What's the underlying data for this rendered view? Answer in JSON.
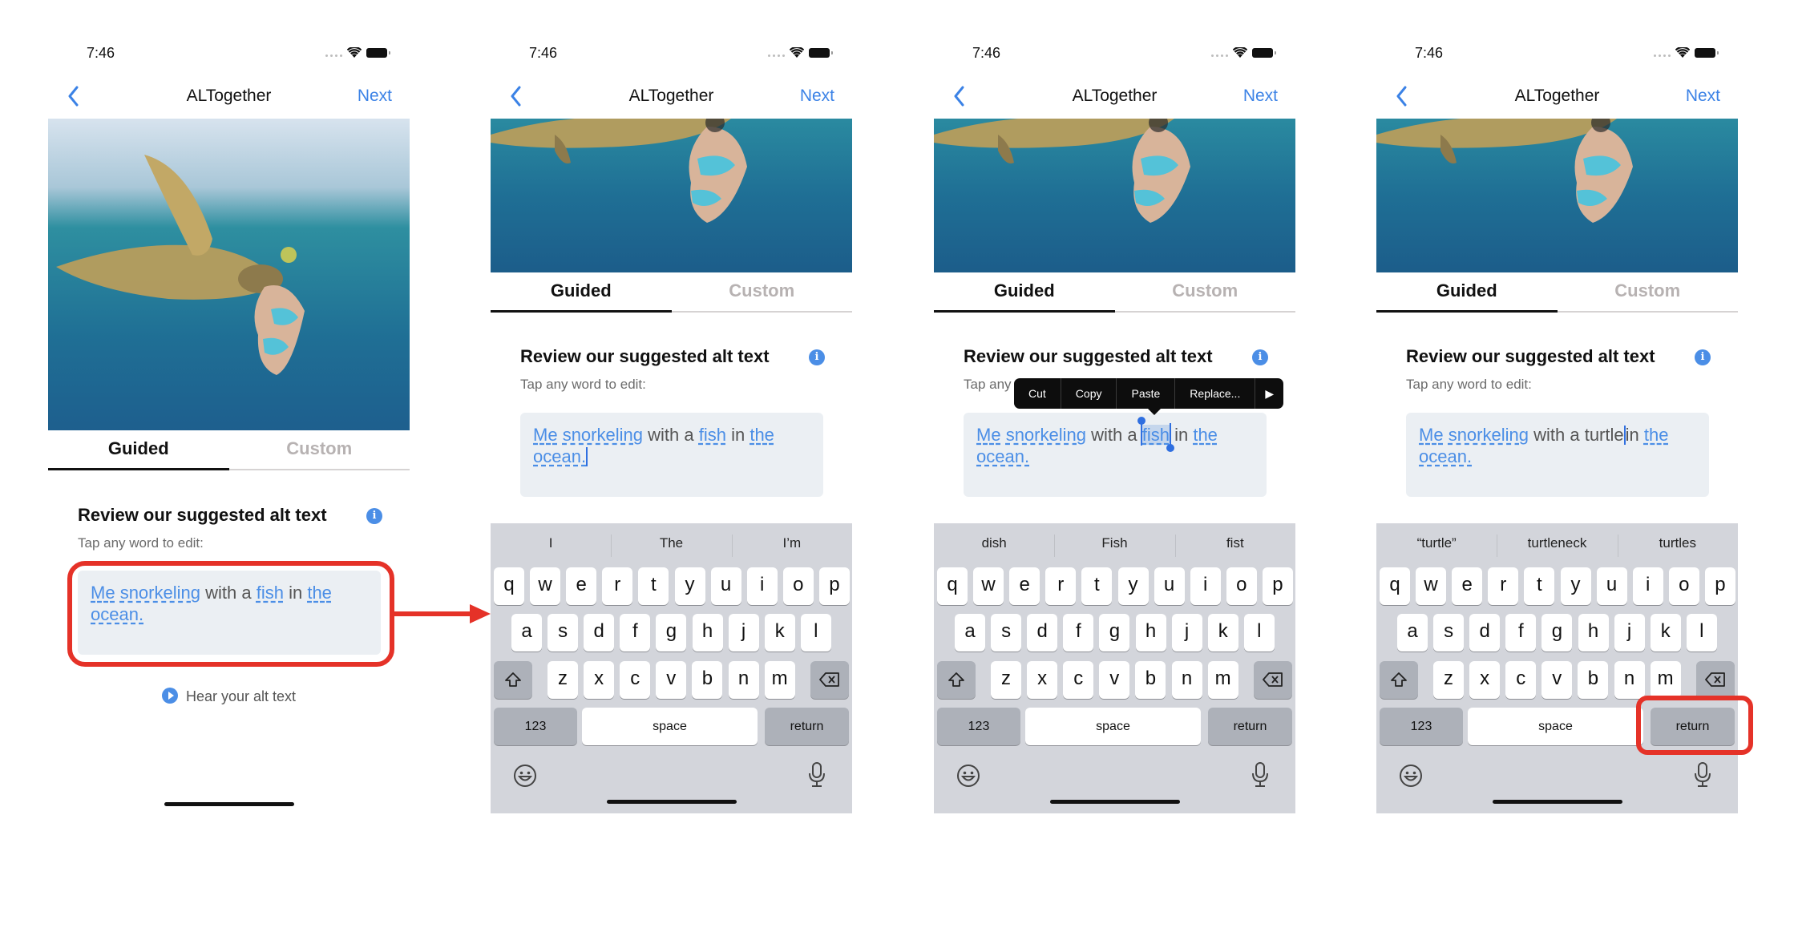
{
  "app": {
    "status_time": "7:46",
    "title": "ALTogether",
    "next_label": "Next",
    "tabs": {
      "guided": "Guided",
      "custom": "Custom"
    },
    "heading": "Review our suggested alt text",
    "subtitle": "Tap any word to edit:",
    "subtitle_truncated": "Tap any",
    "hear_label": "Hear your alt text",
    "info_glyph": "i",
    "icons": [
      "back-chevron-icon",
      "signal-icon",
      "wifi-icon",
      "battery-icon",
      "info-icon",
      "play-icon",
      "shift-icon",
      "backspace-icon",
      "emoji-icon",
      "microphone-icon"
    ]
  },
  "colors": {
    "accent": "#4b8ee6",
    "annotation_red": "#e53228",
    "textbox_bg": "#ebeff3",
    "keyboard_bg": "#d3d5db"
  },
  "screens": [
    {
      "id": "screen-1",
      "alt_text_words": [
        {
          "text": "Me",
          "editable": true
        },
        {
          "text": "snorkeling",
          "editable": true
        },
        {
          "text": "with a",
          "editable": false
        },
        {
          "text": "fish",
          "editable": true
        },
        {
          "text": "in",
          "editable": false
        },
        {
          "text": "the",
          "editable": true
        },
        {
          "text": "ocean.",
          "editable": true
        }
      ]
    },
    {
      "id": "screen-2",
      "suggestions": [
        "I",
        "The",
        "I’m"
      ],
      "alt_text_words": [
        {
          "text": "Me",
          "editable": true
        },
        {
          "text": "snorkeling",
          "editable": true
        },
        {
          "text": "with a",
          "editable": false
        },
        {
          "text": "fish",
          "editable": true
        },
        {
          "text": "in",
          "editable": false
        },
        {
          "text": "the",
          "editable": true
        },
        {
          "text": "ocean.",
          "editable": true
        }
      ]
    },
    {
      "id": "screen-3",
      "suggestions": [
        "dish",
        "Fish",
        "fist"
      ],
      "edit_menu": [
        "Cut",
        "Copy",
        "Paste",
        "Replace...",
        "▶"
      ],
      "selected_word": "fish",
      "alt_text_words": [
        {
          "text": "Me",
          "editable": true
        },
        {
          "text": "snorkeling",
          "editable": true
        },
        {
          "text": "with a",
          "editable": false
        },
        {
          "text": "fish",
          "editable": true
        },
        {
          "text": "in",
          "editable": false
        },
        {
          "text": "the",
          "editable": true
        },
        {
          "text": "ocean.",
          "editable": true
        }
      ]
    },
    {
      "id": "screen-4",
      "suggestions": [
        "“turtle”",
        "turtleneck",
        "turtles"
      ],
      "alt_text_words": [
        {
          "text": "Me",
          "editable": true
        },
        {
          "text": "snorkeling",
          "editable": true
        },
        {
          "text": "with a",
          "editable": false
        },
        {
          "text": "turtle",
          "editable": false
        },
        {
          "text": "in",
          "editable": false
        },
        {
          "text": "the",
          "editable": true
        },
        {
          "text": "ocean.",
          "editable": true
        }
      ]
    }
  ],
  "keyboard": {
    "row1": [
      "q",
      "w",
      "e",
      "r",
      "t",
      "y",
      "u",
      "i",
      "o",
      "p"
    ],
    "row2": [
      "a",
      "s",
      "d",
      "f",
      "g",
      "h",
      "j",
      "k",
      "l"
    ],
    "row3": [
      "z",
      "x",
      "c",
      "v",
      "b",
      "n",
      "m"
    ],
    "numbers_label": "123",
    "space_label": "space",
    "return_label": "return"
  }
}
